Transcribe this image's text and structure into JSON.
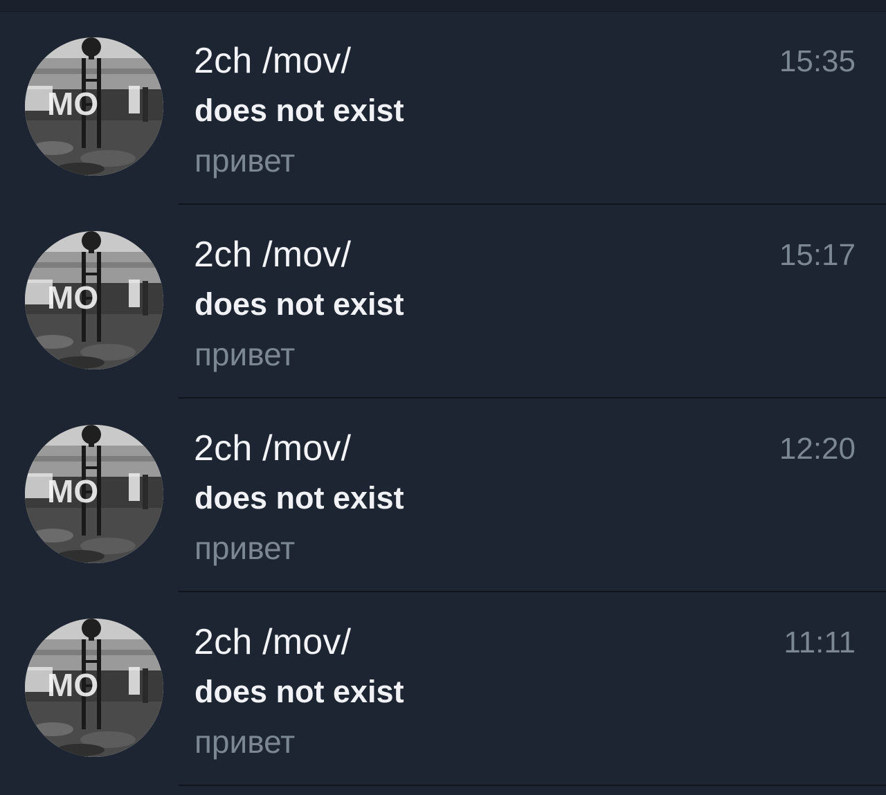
{
  "chats": [
    {
      "title": "2ch /mov/",
      "sender": "does not exist",
      "preview": "привет",
      "time": "15:35",
      "avatar": "mov-avatar"
    },
    {
      "title": "2ch /mov/",
      "sender": "does not exist",
      "preview": "привет",
      "time": "15:17",
      "avatar": "mov-avatar"
    },
    {
      "title": "2ch /mov/",
      "sender": "does not exist",
      "preview": "привет",
      "time": "12:20",
      "avatar": "mov-avatar"
    },
    {
      "title": "2ch /mov/",
      "sender": "does not exist",
      "preview": "привет",
      "time": "11:11",
      "avatar": "mov-avatar"
    }
  ],
  "colors": {
    "background": "#1d2533",
    "title": "#f2f4f7",
    "muted": "#7c8794",
    "divider": "#10151d"
  }
}
